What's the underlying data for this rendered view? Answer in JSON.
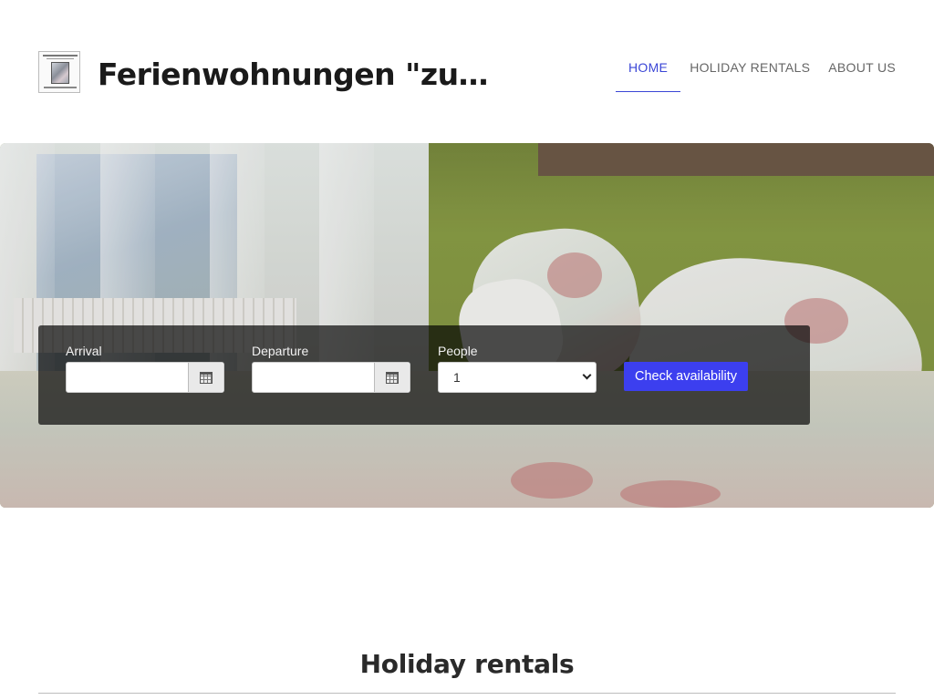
{
  "header": {
    "site_title": "Ferienwohnungen \"zu…",
    "logo_icon": "site-logo"
  },
  "nav": {
    "items": [
      {
        "label": "HOME",
        "active": true
      },
      {
        "label": "HOLIDAY RENTALS",
        "active": false
      },
      {
        "label": "ABOUT US",
        "active": false
      }
    ],
    "active_color": "#3b46d6"
  },
  "booking": {
    "arrival_label": "Arrival",
    "arrival_value": "",
    "departure_label": "Departure",
    "departure_value": "",
    "people_label": "People",
    "people_value": "1",
    "submit_label": "Check availability",
    "submit_color": "#3c3fef",
    "calendar_icon": "calendar-icon"
  },
  "section": {
    "title": "Holiday rentals"
  }
}
